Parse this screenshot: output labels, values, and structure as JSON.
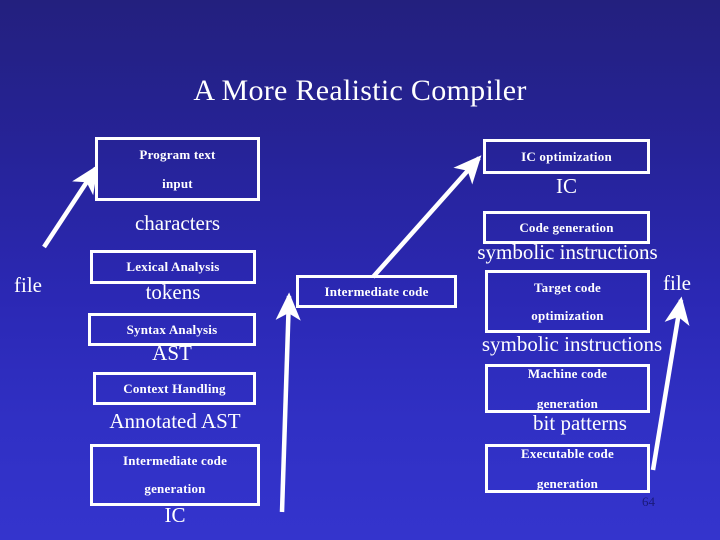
{
  "slide": {
    "title": "A More Realistic Compiler",
    "page_number": "64",
    "background_top_color": "#23207e",
    "background_bottom_color": "#3434cd",
    "box_border_color": "#ffffff",
    "text_color": "#ffffff",
    "page_number_color": "#1a1a7a"
  },
  "left_column": {
    "boxes": [
      {
        "id": "program-text-input",
        "lines": [
          "Program text",
          "input"
        ]
      },
      {
        "id": "lexical-analysis",
        "lines": [
          "Lexical Analysis"
        ]
      },
      {
        "id": "syntax-analysis",
        "lines": [
          "Syntax Analysis"
        ]
      },
      {
        "id": "context-handling",
        "lines": [
          "Context Handling"
        ]
      },
      {
        "id": "intermediate-code-generation",
        "lines": [
          "Intermediate code",
          "generation"
        ]
      }
    ],
    "flow_labels": [
      {
        "id": "characters",
        "text": "characters"
      },
      {
        "id": "tokens",
        "text": "tokens"
      },
      {
        "id": "ast",
        "text": "AST"
      },
      {
        "id": "annotated-ast",
        "text": "Annotated AST"
      },
      {
        "id": "ic",
        "text": "IC"
      }
    ],
    "file_label": "file"
  },
  "middle": {
    "box": {
      "id": "intermediate-code",
      "lines": [
        "Intermediate code"
      ]
    }
  },
  "right_column": {
    "boxes": [
      {
        "id": "ic-optimization",
        "lines": [
          "IC optimization"
        ]
      },
      {
        "id": "code-generation",
        "lines": [
          "Code generation"
        ]
      },
      {
        "id": "target-code-optimization",
        "lines": [
          "Target code",
          "optimization"
        ]
      },
      {
        "id": "machine-code-generation",
        "lines": [
          "Machine code",
          "generation"
        ]
      },
      {
        "id": "executable-code-generation",
        "lines": [
          "Executable code",
          "generation"
        ]
      }
    ],
    "flow_labels": [
      {
        "id": "ic",
        "text": "IC"
      },
      {
        "id": "symbolic-instructions-1",
        "text": "symbolic instructions"
      },
      {
        "id": "symbolic-instructions-2",
        "text": "symbolic instructions"
      },
      {
        "id": "bit-patterns",
        "text": "bit patterns"
      }
    ],
    "file_label": "file"
  }
}
